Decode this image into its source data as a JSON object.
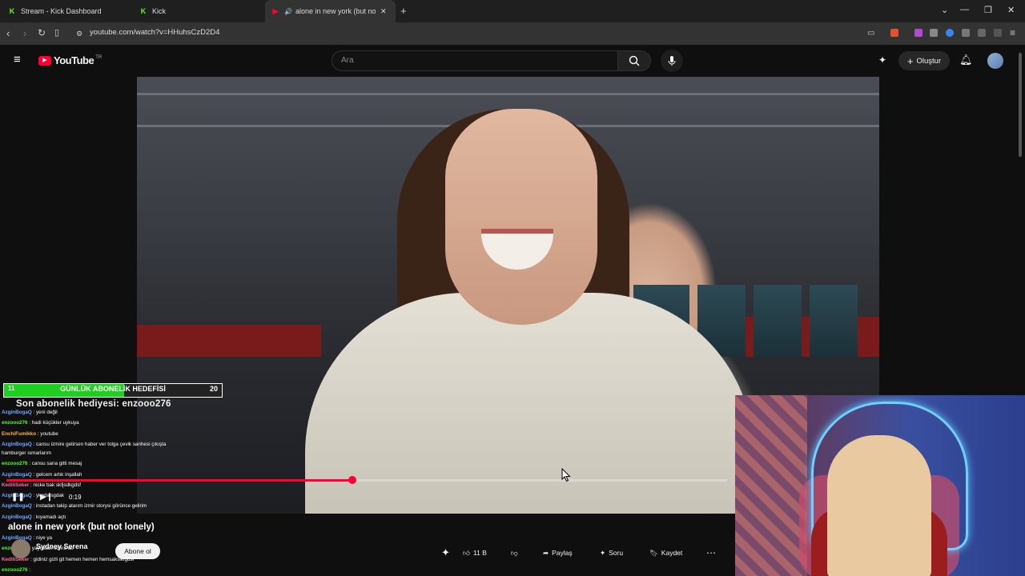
{
  "browser": {
    "tabs": [
      {
        "label": "Stream - Kick Dashboard",
        "icon": "kick-icon"
      },
      {
        "label": "Kick",
        "icon": "kick-icon"
      },
      {
        "label": "alone in new york (but not lo",
        "icon": "youtube-icon",
        "active": true
      }
    ],
    "url": "youtube.com/watch?v=HHuhsCzD2D4"
  },
  "youtube": {
    "logo_text": "YouTube",
    "region": "TR",
    "search_placeholder": "Ara",
    "create_label": "Oluştur"
  },
  "overlay": {
    "goal_label": "GÜNLÜK ABONELİK HEDEFİSİ",
    "goal_current": "11",
    "goal_target": "20",
    "goal_progress": 0.55,
    "last_sub": "Son abonelik hediyesi: enzooo276",
    "chat": [
      {
        "user": "AzginBogaQ",
        "msg": " : yeni değil"
      },
      {
        "user": "enzooo276",
        "msg": " : hadi küçükler uykuya"
      },
      {
        "user": "EnchiFumikko",
        "msg": " : youtube"
      },
      {
        "user": "AzginBogaQ",
        "msg": " : cansu izmire gelirsen haber ver tolga çevik sanhesi çıkışta"
      },
      {
        "user": "",
        "msg": "hamburger ısmarlarım"
      },
      {
        "user": "enzooo276",
        "msg": " : cansu sana gitti mesaj"
      },
      {
        "user": "AzginBogaQ",
        "msg": " : gelcem artık inşallah"
      },
      {
        "user": "KediliSeker",
        "msg": " : nicke bak skfjsdkgdsf"
      },
      {
        "user": "AzginBogaQ",
        "msg": " : ykgdajsgdak"
      },
      {
        "user": "AzginBogaQ",
        "msg": " : instadan takip atarım izmir storysi görünce gelirim"
      },
      {
        "user": "AzginBogaQ",
        "msg": " : kıyamadı açtı"
      },
      {
        "user": "AzginBogaQ",
        "msg": " : niye ya"
      },
      {
        "user": "enzooo276",
        "msg": " : yayından sonra ac"
      },
      {
        "user": "KediliSeker",
        "msg": " : gidiniz gizli git hemen hemen hemsakslkfgdsf"
      },
      {
        "user": "enzooo276",
        "msg": " :"
      }
    ]
  },
  "player": {
    "progress": 0.48,
    "time": "0:19",
    "title": "alone in new york (but not lonely)",
    "channel": "Sydney Serena",
    "subscribe_label": "Abone ol",
    "like_count": "11 B",
    "share_label": "Paylaş",
    "ask_label": "Soru",
    "save_label": "Kaydet"
  },
  "colors": {
    "youtube_red": "#ff0033",
    "kick_green": "#53fc18",
    "goal_green": "#1fcf1f"
  }
}
